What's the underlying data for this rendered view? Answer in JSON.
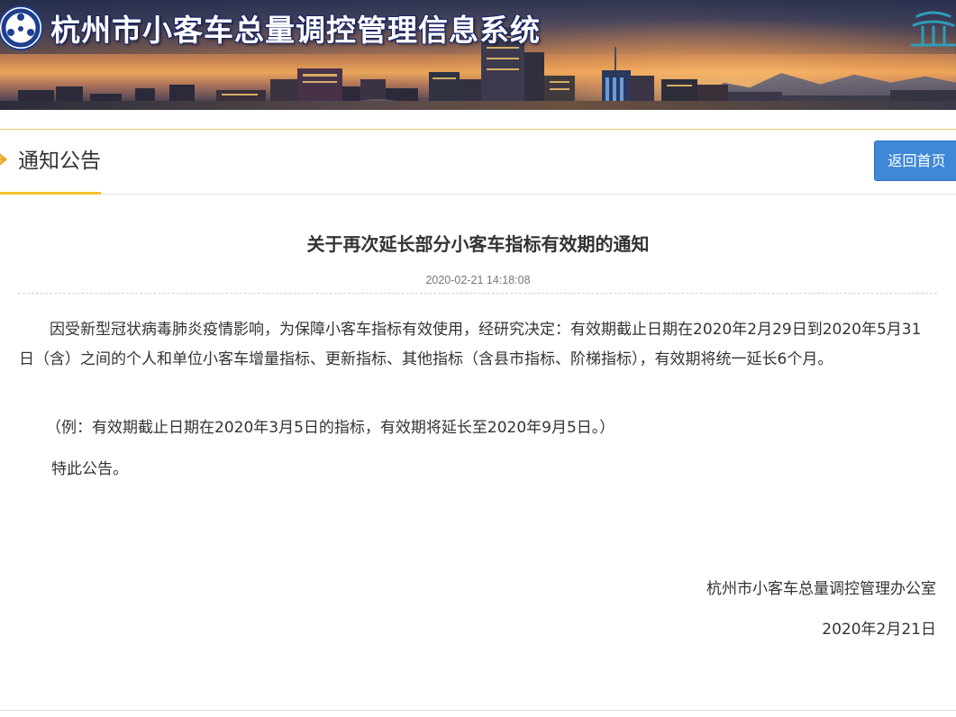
{
  "header": {
    "site_title": "杭州市小客车总量调控管理信息系统",
    "logo_icon": "hangzhou-traffic-logo-icon",
    "emblem_icon": "pavilion-emblem-icon"
  },
  "section": {
    "title": "通知公告",
    "arrow_icon": "arrow-right-icon",
    "home_button_label": "返回首页",
    "accent_color": "#f3c230",
    "button_color": "#3f88d8"
  },
  "notice": {
    "title": "关于再次延长部分小客车指标有效期的通知",
    "timestamp": "2020-02-21 14:18:08",
    "paragraphs": [
      "因受新型冠状病毒肺炎疫情影响，为保障小客车指标有效使用，经研究决定：有效期截止日期在2020年2月29日到2020年5月31日（含）之间的个人和单位小客车增量指标、更新指标、其他指标（含县市指标、阶梯指标），有效期将统一延长6个月。",
      "（例：有效期截止日期在2020年3月5日的指标，有效期将延长至2020年9月5日。）",
      "特此公告。"
    ],
    "signature_office": "杭州市小客车总量调控管理办公室",
    "signature_date": "2020年2月21日"
  }
}
